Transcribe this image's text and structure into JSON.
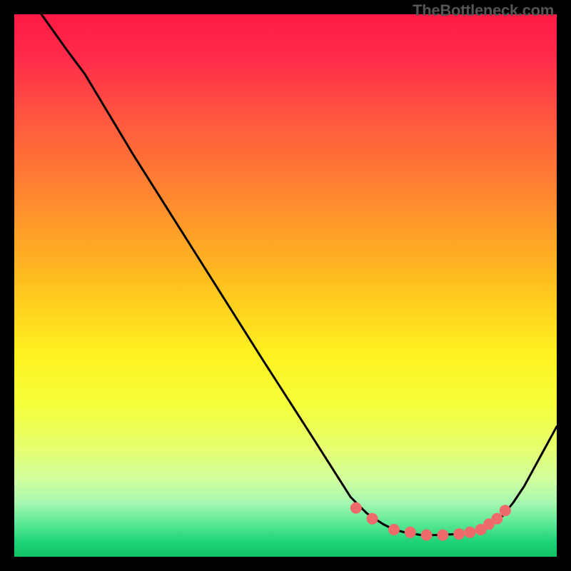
{
  "watermark": "TheBottleneck.com",
  "gradient": {
    "stops": [
      {
        "offset": 0.0,
        "color": "#ff1a45"
      },
      {
        "offset": 0.08,
        "color": "#ff2b4a"
      },
      {
        "offset": 0.2,
        "color": "#ff5a3e"
      },
      {
        "offset": 0.35,
        "color": "#ff8c2e"
      },
      {
        "offset": 0.5,
        "color": "#ffc21e"
      },
      {
        "offset": 0.62,
        "color": "#fff020"
      },
      {
        "offset": 0.72,
        "color": "#f5ff3a"
      },
      {
        "offset": 0.8,
        "color": "#e7ff70"
      },
      {
        "offset": 0.86,
        "color": "#cfffa0"
      },
      {
        "offset": 0.9,
        "color": "#a6f7b0"
      },
      {
        "offset": 0.94,
        "color": "#58e894"
      },
      {
        "offset": 0.97,
        "color": "#22d47a"
      },
      {
        "offset": 1.0,
        "color": "#0fc264"
      }
    ]
  },
  "chart_data": {
    "type": "line",
    "title": "",
    "xlabel": "",
    "ylabel": "",
    "xlim": [
      0,
      100
    ],
    "ylim": [
      0,
      100
    ],
    "series": [
      {
        "name": "curve",
        "x": [
          5,
          10,
          13,
          22,
          34,
          46,
          55,
          62,
          65,
          68,
          70,
          72,
          75,
          78,
          82,
          86,
          88,
          90,
          92,
          94,
          100
        ],
        "y": [
          100,
          93,
          89,
          74,
          55,
          36,
          22,
          11,
          8,
          6,
          5,
          4.5,
          4,
          4,
          4.2,
          5,
          6,
          7.5,
          10,
          13,
          24
        ]
      }
    ],
    "markers": {
      "name": "dots",
      "x": [
        63,
        66,
        70,
        73,
        76,
        79,
        82,
        84,
        86,
        87.5,
        89,
        90.5
      ],
      "y": [
        9,
        7,
        5,
        4.5,
        4,
        4,
        4.2,
        4.5,
        5,
        6,
        7,
        8.5
      ]
    }
  }
}
